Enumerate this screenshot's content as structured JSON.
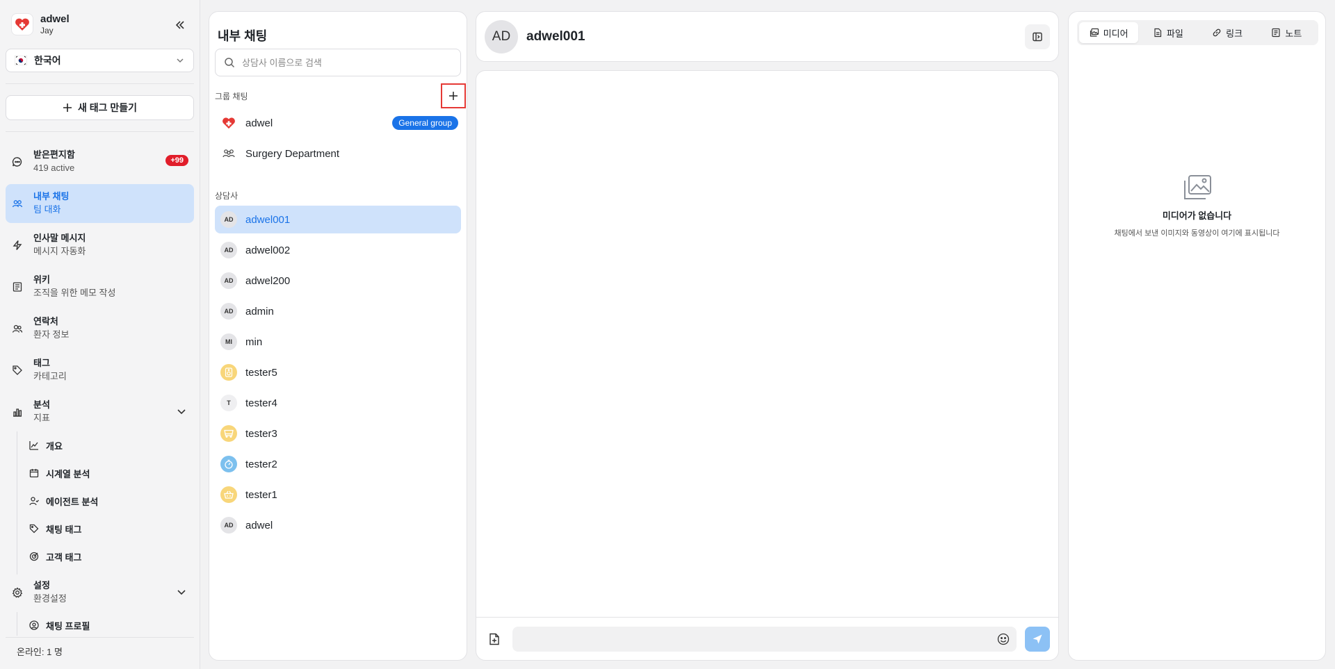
{
  "brand": {
    "name": "adwel",
    "user": "Jay"
  },
  "language": {
    "flag_icon": "korea-flag-icon",
    "selected": "한국어"
  },
  "new_tag_label": "새 태그 만들기",
  "nav": {
    "inbox": {
      "title": "받은편지함",
      "sub": "419 active",
      "badge": "+99"
    },
    "internal": {
      "title": "내부 채팅",
      "sub": "팀 대화"
    },
    "greeting": {
      "title": "인사말 메시지",
      "sub": "메시지 자동화"
    },
    "wiki": {
      "title": "위키",
      "sub": "조직을 위한 메모 작성"
    },
    "contacts": {
      "title": "연락처",
      "sub": "환자 정보"
    },
    "tags": {
      "title": "태그",
      "sub": "카테고리"
    },
    "analytics": {
      "title": "분석",
      "sub": "지표",
      "items": [
        "개요",
        "시계열 분석",
        "에이전트 분석",
        "채팅 태그",
        "고객 태그"
      ]
    },
    "settings": {
      "title": "설정",
      "sub": "환경설정",
      "items": [
        "채팅 프로필"
      ]
    }
  },
  "online": "온라인: 1 명",
  "chat_list": {
    "title": "내부 채팅",
    "search_placeholder": "상담사 이름으로 검색",
    "group_section": "그룹 채팅",
    "groups": [
      {
        "name": "adwel",
        "tag": "General group"
      },
      {
        "name": "Surgery Department"
      }
    ],
    "agent_section": "상담사",
    "agents": [
      {
        "initials": "AD",
        "name": "adwel001"
      },
      {
        "initials": "AD",
        "name": "adwel002"
      },
      {
        "initials": "AD",
        "name": "adwel200"
      },
      {
        "initials": "AD",
        "name": "admin"
      },
      {
        "initials": "MI",
        "name": "min"
      },
      {
        "initials": "",
        "name": "tester5"
      },
      {
        "initials": "T",
        "name": "tester4"
      },
      {
        "initials": "",
        "name": "tester3"
      },
      {
        "initials": "",
        "name": "tester2"
      },
      {
        "initials": "",
        "name": "tester1"
      },
      {
        "initials": "AD",
        "name": "adwel"
      }
    ]
  },
  "conversation": {
    "initials": "AD",
    "name": "adwel001"
  },
  "media": {
    "tabs": [
      "미디어",
      "파일",
      "링크",
      "노트"
    ],
    "empty_title": "미디어가 없습니다",
    "empty_desc": "채팅에서 보낸 이미지와 동영상이 여기에 표시됩니다"
  },
  "colors": {
    "accent": "#1a73e8",
    "badge": "#e11d2a",
    "active_bg": "#cfe2fb"
  }
}
